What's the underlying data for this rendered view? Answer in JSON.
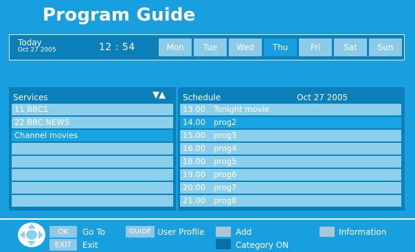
{
  "title": "Program Guide",
  "header": {
    "today_label": "Today",
    "today_date": "Oct 27  2005",
    "clock": "12 : 54",
    "days": [
      "Mon",
      "Tue",
      "Wed",
      "Thu",
      "Fri",
      "Sat",
      "Sun"
    ],
    "active_day": "Thu"
  },
  "services": {
    "header": "Services",
    "arrows": "▼▲",
    "items": [
      "11 BBC1",
      "22 BBC NEWS",
      "Channel movies",
      "",
      "",
      "",
      "",
      ""
    ],
    "selected_index": 2
  },
  "schedule": {
    "header": "Schedule",
    "date": "Oct 27  2005",
    "items": [
      {
        "time": "13.00",
        "title": "Tonight movie"
      },
      {
        "time": "14.00",
        "title": "prog2"
      },
      {
        "time": "15.00",
        "title": "prog3"
      },
      {
        "time": "16.00",
        "title": "prog4"
      },
      {
        "time": "18.00",
        "title": "prog5"
      },
      {
        "time": "19.00",
        "title": "prog6"
      },
      {
        "time": "20.00",
        "title": "prog7"
      },
      {
        "time": "21.00",
        "title": "prog8"
      }
    ],
    "selected_index": 1
  },
  "footer": {
    "ok_key": "OK",
    "ok_label": "Go To",
    "exit_key": "EXIT",
    "exit_label": "Exit",
    "guide_key": "GUIDE",
    "guide_label": "User Profile",
    "add_label": "Add",
    "category_label": "Category ON",
    "info_label": "Information"
  },
  "colors": {
    "background": "#189fdf",
    "panel": "#0b7fb9",
    "row": "#8ccfed",
    "selected_row": "#18a3e2",
    "key_grey": "#8fc8e6",
    "swatch_grey": "#a8c8d8",
    "swatch_blue": "#0b6fa8"
  },
  "icons": {
    "navigation": "dpad-icon"
  }
}
